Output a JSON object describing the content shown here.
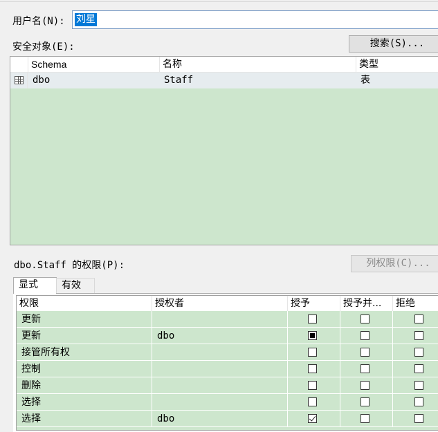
{
  "login": {
    "label": "用户名(N):",
    "value": "刘星"
  },
  "securables": {
    "label": "安全对象(E):",
    "search_button": "搜索(S)...",
    "columns": [
      "Schema",
      "名称",
      "类型"
    ],
    "rows": [
      {
        "schema": "dbo",
        "name": "Staff",
        "type": "表",
        "icon": "table-icon"
      }
    ]
  },
  "permissions": {
    "label": "dbo.Staff 的权限(P):",
    "column_perms_button": "列权限(C)...",
    "tabs": [
      "显式",
      "有效"
    ],
    "columns": [
      "权限",
      "授权者",
      "授予",
      "授予并...",
      "拒绝"
    ],
    "rows": [
      {
        "permission": "更新",
        "grantor": "",
        "grant": "unchecked",
        "with_grant": "unchecked",
        "deny": "unchecked"
      },
      {
        "permission": "更新",
        "grantor": "dbo",
        "grant": "granted",
        "with_grant": "unchecked",
        "deny": "unchecked"
      },
      {
        "permission": "接管所有权",
        "grantor": "",
        "grant": "unchecked",
        "with_grant": "unchecked",
        "deny": "unchecked"
      },
      {
        "permission": "控制",
        "grantor": "",
        "grant": "unchecked",
        "with_grant": "unchecked",
        "deny": "unchecked"
      },
      {
        "permission": "删除",
        "grantor": "",
        "grant": "unchecked",
        "with_grant": "unchecked",
        "deny": "unchecked"
      },
      {
        "permission": "选择",
        "grantor": "",
        "grant": "unchecked",
        "with_grant": "unchecked",
        "deny": "unchecked"
      },
      {
        "permission": "选择",
        "grantor": "dbo",
        "grant": "checked",
        "with_grant": "unchecked",
        "deny": "unchecked"
      }
    ]
  },
  "colors": {
    "grid_background": "#cde6cd",
    "selection": "#0078d7"
  }
}
